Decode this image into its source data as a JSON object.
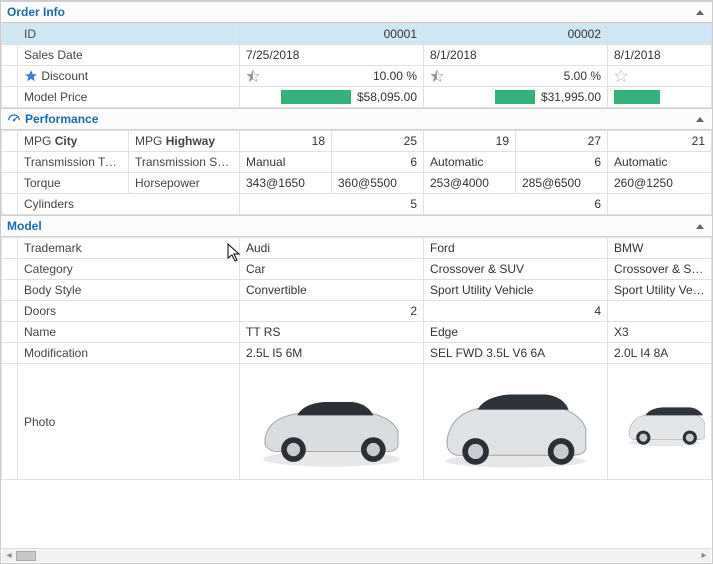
{
  "order_info": {
    "title": "Order Info",
    "rows": {
      "id": {
        "label": "ID",
        "c1": "00001",
        "c2": "00002",
        "c3": ""
      },
      "sales_date": {
        "label": "Sales Date",
        "c1": "7/25/2018",
        "c2": "8/1/2018",
        "c3": "8/1/2018"
      },
      "discount": {
        "label": "Discount",
        "c1": "10.00 %",
        "c2": "5.00 %",
        "c3": ""
      },
      "model_price": {
        "label": "Model Price",
        "c1": "$58,095.00",
        "c2": "$31,995.00",
        "c3": ""
      }
    },
    "star_states": {
      "c1": "half",
      "c2": "half",
      "c3": "empty",
      "label_star": "full"
    }
  },
  "performance": {
    "title": "Performance",
    "rows": {
      "mpg": {
        "label_a": "MPG",
        "label_a_bold": "City",
        "label_b": "MPG",
        "label_b_bold": "Highway",
        "c1a": "18",
        "c1b": "25",
        "c2a": "19",
        "c2b": "27",
        "c3a": "21"
      },
      "trans": {
        "label_a": "Transmission Type",
        "label_b": "Transmission Speeds",
        "c1a": "Manual",
        "c1b": "6",
        "c2a": "Automatic",
        "c2b": "6",
        "c3a": "Automatic"
      },
      "torque_hp": {
        "label_a": "Torque",
        "label_b": "Horsepower",
        "c1a": "343@1650",
        "c1b": "360@5500",
        "c2a": "253@4000",
        "c2b": "285@6500",
        "c3a": "260@1250"
      },
      "cylinders": {
        "label": "Cylinders",
        "c1": "5",
        "c2": "6",
        "c3": ""
      }
    }
  },
  "model": {
    "title": "Model",
    "rows": {
      "trademark": {
        "label": "Trademark",
        "c1": "Audi",
        "c2": "Ford",
        "c3": "BMW"
      },
      "category": {
        "label": "Category",
        "c1": "Car",
        "c2": "Crossover & SUV",
        "c3": "Crossover & SUV"
      },
      "body_style": {
        "label": "Body Style",
        "c1": "Convertible",
        "c2": "Sport Utility Vehicle",
        "c3": "Sport Utility Vehicle"
      },
      "doors": {
        "label": "Doors",
        "c1": "2",
        "c2": "4",
        "c3": ""
      },
      "name": {
        "label": "Name",
        "c1": "TT RS",
        "c2": "Edge",
        "c3": "X3"
      },
      "modification": {
        "label": "Modification",
        "c1": "2.5L I5 6M",
        "c2": "SEL FWD 3.5L V6 6A",
        "c3": "2.0L I4 8A"
      },
      "photo": {
        "label": "Photo"
      }
    }
  },
  "colors": {
    "accent": "#1b6ab0",
    "bar": "#34b27b",
    "highlight": "#cfe8f6"
  }
}
